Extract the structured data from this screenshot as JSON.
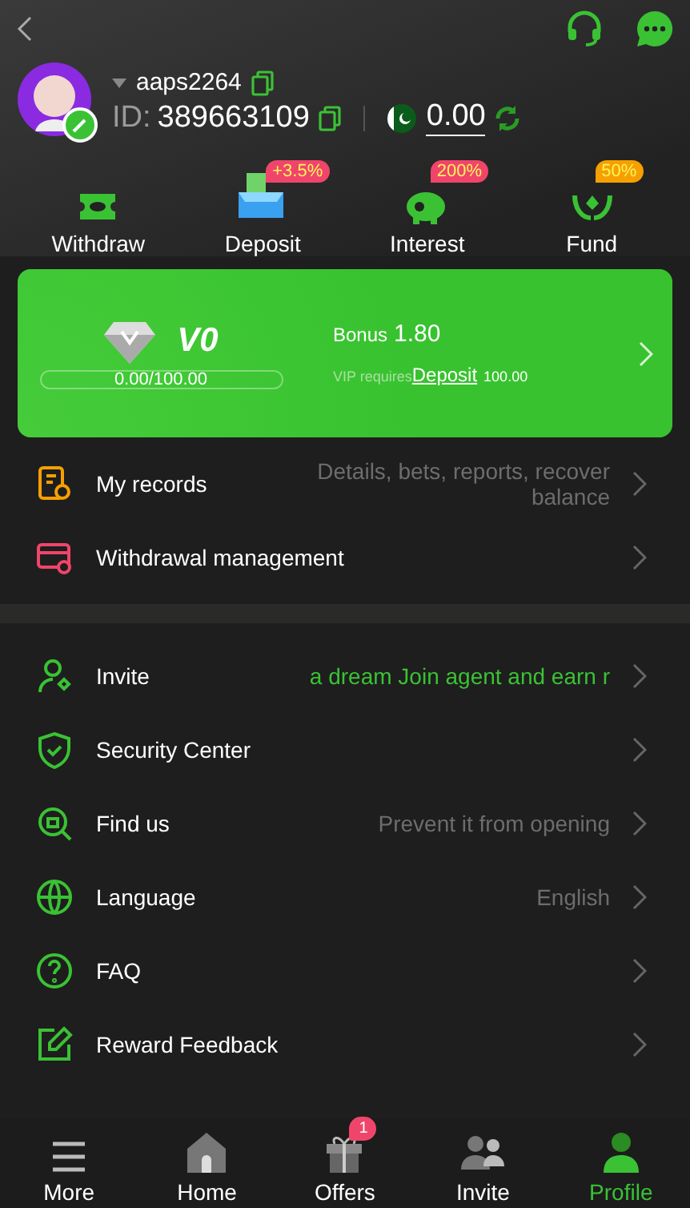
{
  "profile": {
    "username": "aaps2264",
    "id_label": "ID:",
    "id": "389663109",
    "balance": "0.00"
  },
  "quick_actions": [
    {
      "label": "Withdraw"
    },
    {
      "label": "Deposit",
      "badge": "+3.5%",
      "color": "#f0456a"
    },
    {
      "label": "Interest",
      "badge": "200%",
      "color": "#f0456a"
    },
    {
      "label": "Fund",
      "badge": "50%",
      "color": "#f5a000"
    }
  ],
  "vip_card": {
    "level_name": "V0",
    "progress": "0.00/100.00",
    "level": 0,
    "bonus_label": "Bonus",
    "bonus": "1.80",
    "requires_text": "VIP requires",
    "requires_link": "Deposit",
    "requires_amount": "100.00"
  },
  "records": [
    {
      "label": "My records",
      "hint": "Details, bets, reports, recover balance",
      "promo": false
    },
    {
      "label": "Withdrawal management"
    }
  ],
  "menu": [
    {
      "label": "Invite",
      "hint": "a dream  Join agent and earn r",
      "promo": true
    },
    {
      "label": "Security Center"
    },
    {
      "label": "Find us",
      "hint": "Prevent it from opening",
      "promo": false
    },
    {
      "label": "Language",
      "hint": "English",
      "promo": false
    },
    {
      "label": "FAQ"
    },
    {
      "label": "Reward Feedback"
    }
  ],
  "bottom_nav": [
    {
      "label": "More",
      "selected": false
    },
    {
      "label": "Home",
      "selected": false
    },
    {
      "label": "Offers",
      "selected": false,
      "badge": "1"
    },
    {
      "label": "Invite",
      "selected": false
    },
    {
      "label": "Profile",
      "selected": true
    }
  ]
}
